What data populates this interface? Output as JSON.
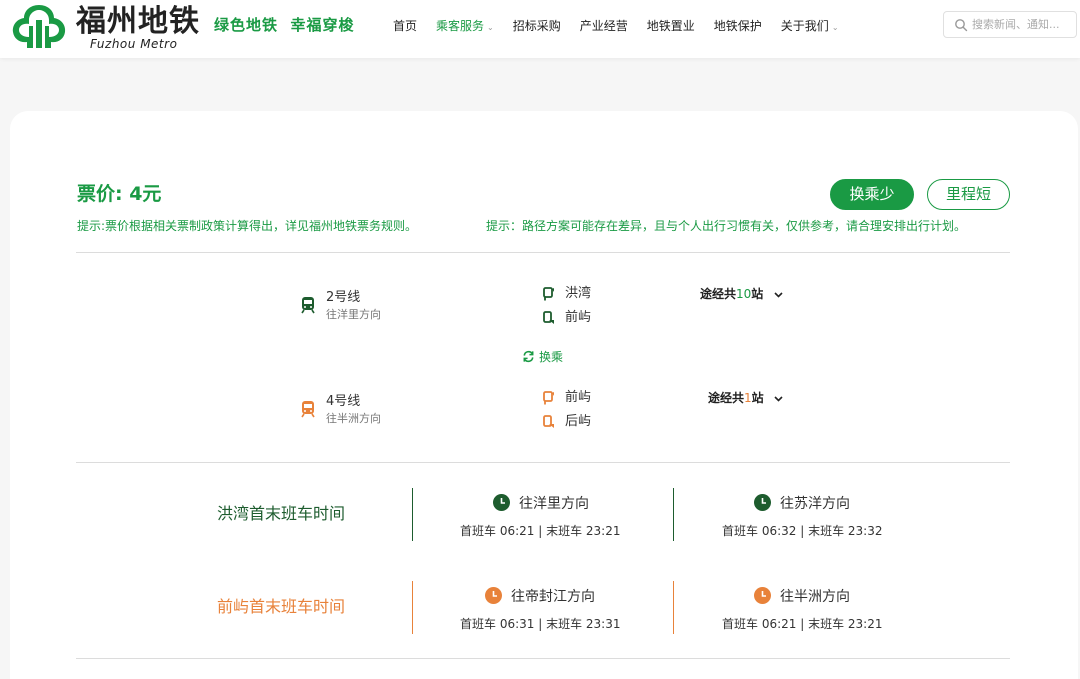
{
  "header": {
    "brand_cn": "福州地铁",
    "brand_en": "Fuzhou Metro",
    "slogan": "绿色地铁  幸福穿梭",
    "nav": [
      {
        "label": "首页"
      },
      {
        "label": "乘客服务",
        "active": true,
        "has_dropdown": true
      },
      {
        "label": "招标采购"
      },
      {
        "label": "产业经营"
      },
      {
        "label": "地铁置业"
      },
      {
        "label": "地铁保护"
      },
      {
        "label": "关于我们",
        "has_dropdown": true
      }
    ],
    "search_placeholder": "搜索新闻、通知..."
  },
  "result": {
    "fare": "票价: 4元",
    "buttons": {
      "fewest_transfers": "换乘少",
      "shortest_distance": "里程短"
    },
    "tip_fare": "提示:票价根据相关票制政策计算得出，详见福州地铁票务规则。",
    "tip_route": "提示：路径方案可能存在差异，且与个人出行习惯有关，仅供参考，请合理安排出行计划。",
    "segments": [
      {
        "line": "2号线",
        "direction": "往洋里方向",
        "color": "#1d5c2e",
        "from": "洪湾",
        "to": "前屿",
        "via_prefix": "途经共",
        "via_count": "10",
        "via_suffix": "站"
      },
      {
        "line": "4号线",
        "direction": "往半洲方向",
        "color": "#e8823a",
        "from": "前屿",
        "to": "后屿",
        "via_prefix": "途经共",
        "via_count": "1",
        "via_suffix": "站"
      }
    ],
    "transfer_label": "换乘"
  },
  "schedules": [
    {
      "title": "洪湾首末班车时间",
      "color": "#1d5c2e",
      "directions": [
        {
          "name": "往洋里方向",
          "times": "首班车 06:21 | 末班车 23:21"
        },
        {
          "name": "往苏洋方向",
          "times": "首班车 06:32 | 末班车 23:32"
        }
      ]
    },
    {
      "title": "前屿首末班车时间",
      "color": "#e8823a",
      "directions": [
        {
          "name": "往帝封江方向",
          "times": "首班车 06:31 | 末班车 23:31"
        },
        {
          "name": "往半洲方向",
          "times": "首班车 06:21 | 末班车 23:21"
        }
      ]
    }
  ],
  "colors": {
    "brand_green": "#1a9a44",
    "line2": "#1d5c2e",
    "line4": "#e8823a"
  }
}
